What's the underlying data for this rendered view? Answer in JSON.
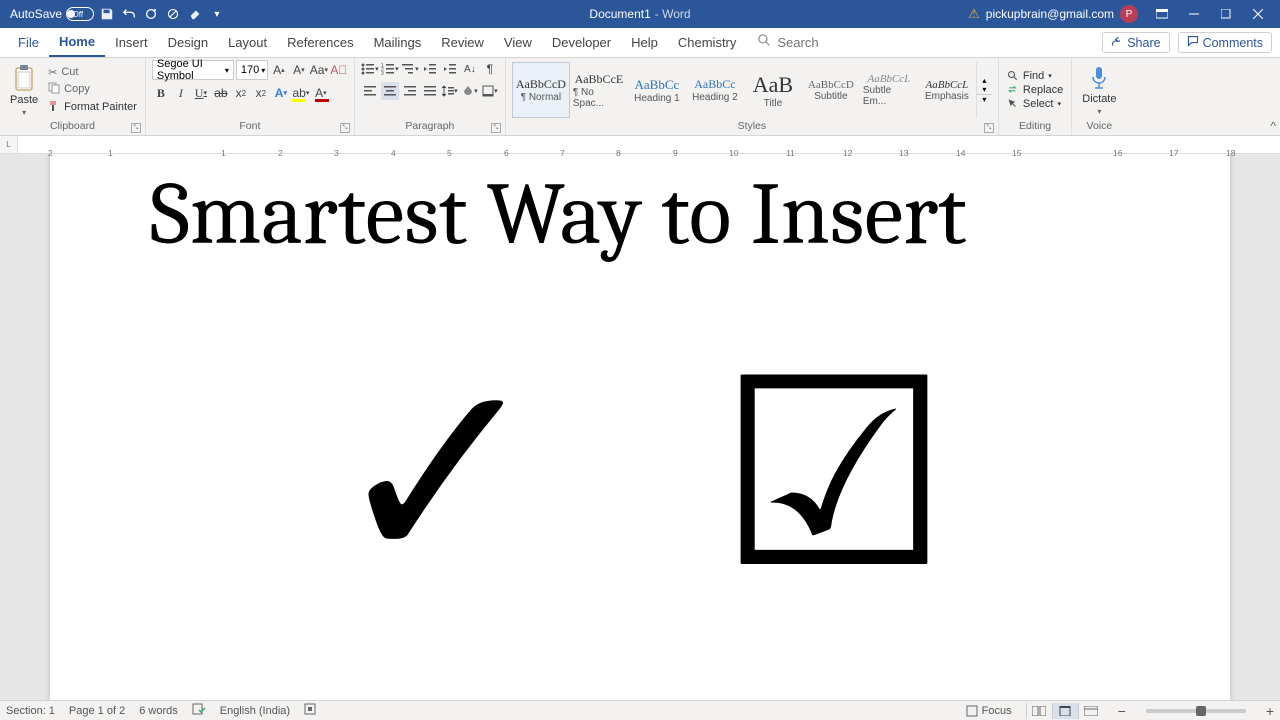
{
  "titlebar": {
    "autosave_label": "AutoSave",
    "autosave_state": "Off",
    "doc_title": "Document1",
    "app_name": "Word",
    "user_email": "pickupbrain@gmail.com",
    "avatar_initial": "P"
  },
  "tabs": {
    "items": [
      "File",
      "Home",
      "Insert",
      "Design",
      "Layout",
      "References",
      "Mailings",
      "Review",
      "View",
      "Developer",
      "Help",
      "Chemistry"
    ],
    "active_index": 1,
    "search_placeholder": "Search",
    "share_label": "Share",
    "comments_label": "Comments"
  },
  "ribbon": {
    "clipboard": {
      "paste": "Paste",
      "cut": "Cut",
      "copy": "Copy",
      "format_painter": "Format Painter",
      "group": "Clipboard"
    },
    "font": {
      "name": "Segoe UI Symbol",
      "size": "170",
      "group": "Font"
    },
    "paragraph": {
      "group": "Paragraph"
    },
    "styles": {
      "items": [
        {
          "preview": "AaBbCcD",
          "label": "¶ Normal"
        },
        {
          "preview": "AaBbCcE",
          "label": "¶ No Spac..."
        },
        {
          "preview": "AaBbCc",
          "label": "Heading 1"
        },
        {
          "preview": "AaBbCc",
          "label": "Heading 2"
        },
        {
          "preview": "AaB",
          "label": "Title"
        },
        {
          "preview": "AaBbCcD",
          "label": "Subtitle"
        },
        {
          "preview": "AaBbCcL",
          "label": "Subtle Em..."
        },
        {
          "preview": "AaBbCcL",
          "label": "Emphasis"
        }
      ],
      "selected_index": 0,
      "group": "Styles"
    },
    "editing": {
      "find": "Find",
      "replace": "Replace",
      "select": "Select",
      "group": "Editing"
    },
    "voice": {
      "dictate": "Dictate",
      "group": "Voice"
    }
  },
  "document": {
    "heading_text": "Smartest Way to Insert",
    "symbol_check": "✓",
    "symbol_checkbox": "☑"
  },
  "statusbar": {
    "section": "Section: 1",
    "page": "Page 1 of 2",
    "words": "6 words",
    "language": "English (India)",
    "focus": "Focus"
  },
  "ruler": {
    "numbers": [
      "2",
      "1",
      "1",
      "2",
      "3",
      "4",
      "5",
      "6",
      "7",
      "8",
      "9",
      "10",
      "11",
      "12",
      "13",
      "14",
      "15",
      "16",
      "17",
      "18"
    ]
  }
}
